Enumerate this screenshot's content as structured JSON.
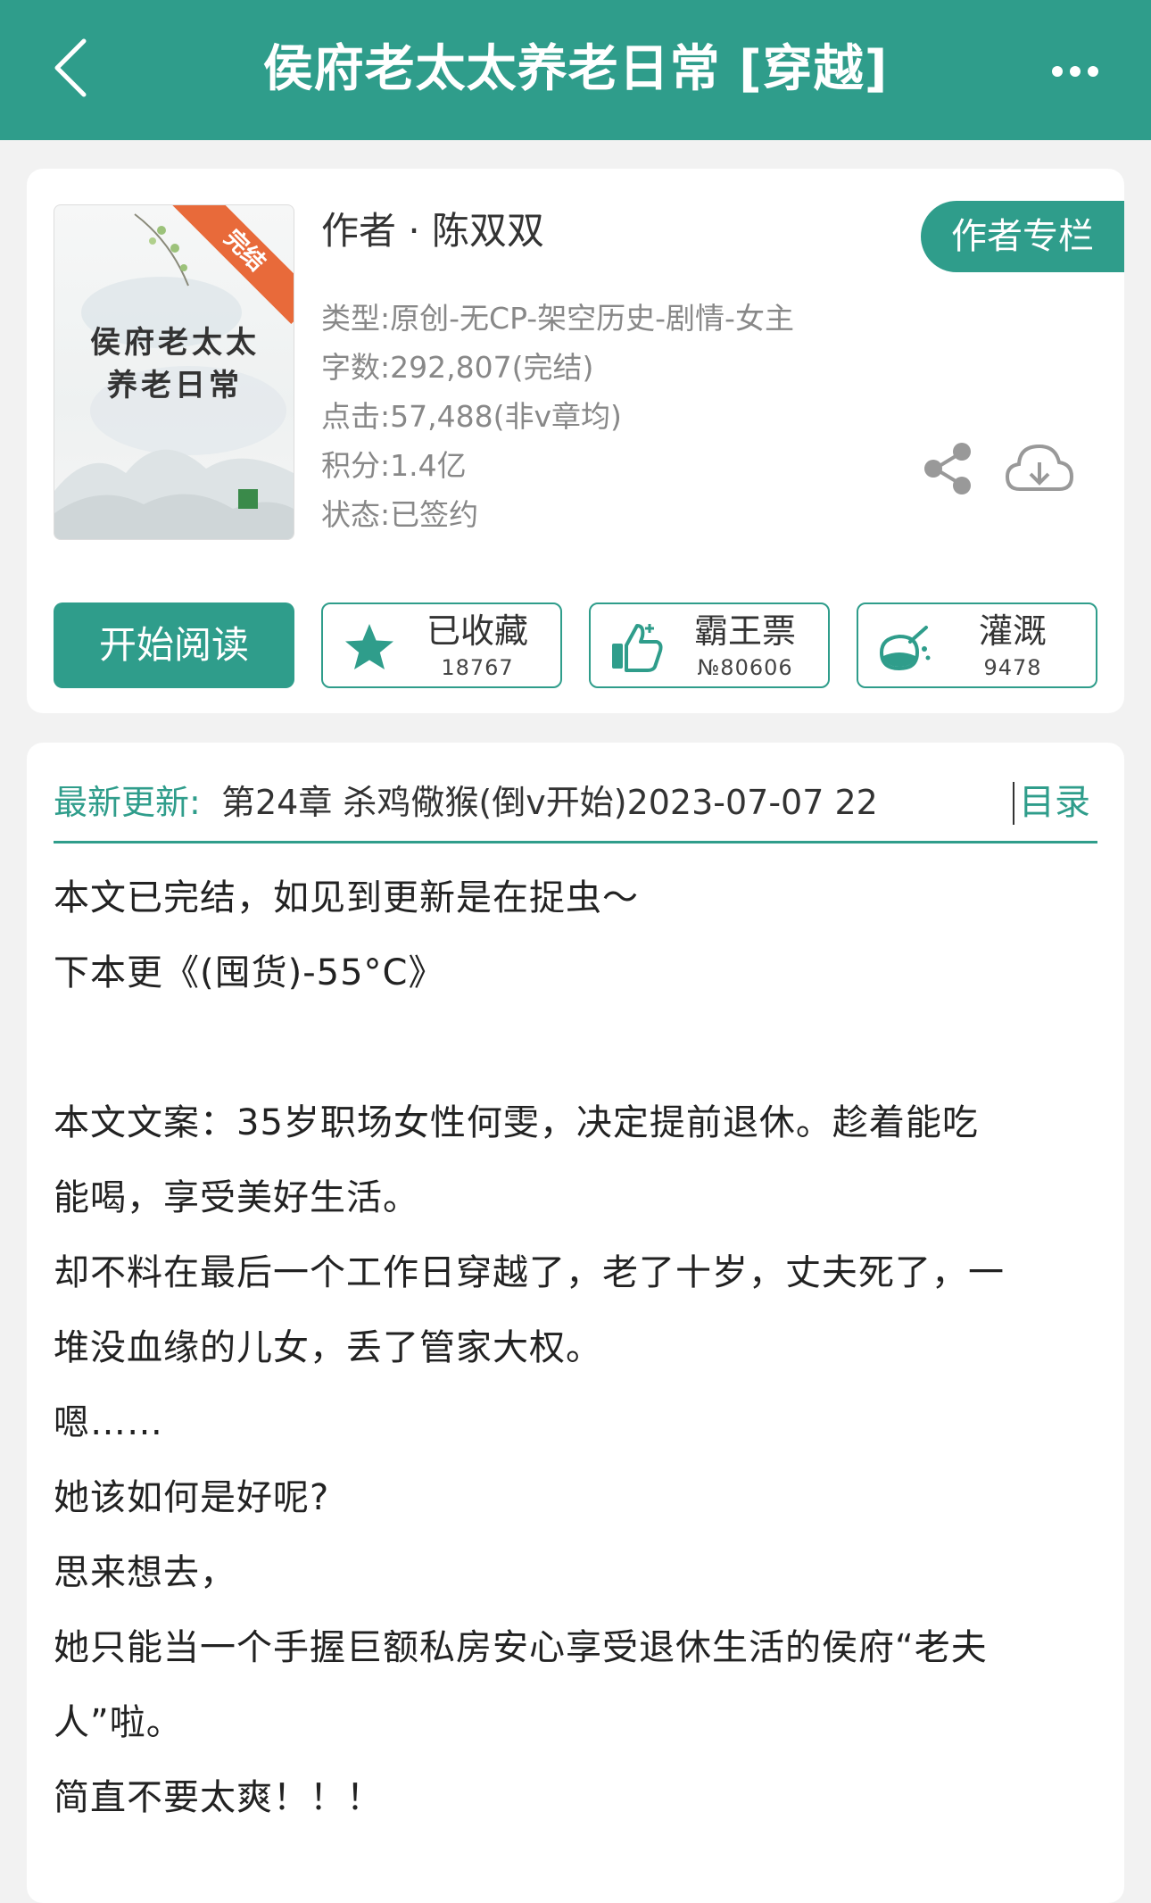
{
  "header": {
    "title": "侯府老太太养老日常 [穿越]"
  },
  "book": {
    "cover_title": "侯府老太太养老日常",
    "cover_badge": "完结",
    "author_line": "作者 · 陈双双",
    "author_column_label": "作者专栏",
    "meta": [
      "类型:原创-无CP-架空历史-剧情-女主",
      "字数:292,807(完结)",
      "点击:57,488(非v章均)",
      "积分:1.4亿",
      "状态:已签约"
    ]
  },
  "actions": {
    "read_label": "开始阅读",
    "collect": {
      "label": "已收藏",
      "count": "18767"
    },
    "vote": {
      "label": "霸王票",
      "count": "№80606"
    },
    "water": {
      "label": "灌溉",
      "count": "9478"
    }
  },
  "update": {
    "label": "最新更新:",
    "text": "第24章 杀鸡儆猴(倒v开始)2023-07-07 22",
    "toc_label": "目录"
  },
  "description": [
    "本文已完结，如见到更新是在捉虫～",
    "下本更《(囤货)-55°C》",
    "",
    "本文文案：35岁职场女性何雯，决定提前退休。趁着能吃",
    "能喝，享受美好生活。",
    "却不料在最后一个工作日穿越了，老了十岁，丈夫死了，一",
    "堆没血缘的儿女，丢了管家大权。",
    "嗯……",
    "她该如何是好呢?",
    "思来想去，",
    "她只能当一个手握巨额私房安心享受退休生活的侯府“老夫",
    "人”啦。",
    "简直不要太爽！！！"
  ],
  "colors": {
    "accent": "#2f9d8b",
    "badge": "#e86a3a",
    "background": "#f2f2f2"
  }
}
